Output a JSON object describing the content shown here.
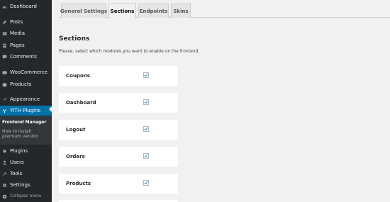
{
  "sidebar": {
    "items": [
      {
        "label": "Dashboard",
        "icon": "dashboard-icon"
      },
      {
        "label": "Posts",
        "icon": "pin-icon"
      },
      {
        "label": "Media",
        "icon": "media-icon"
      },
      {
        "label": "Pages",
        "icon": "page-icon"
      },
      {
        "label": "Comments",
        "icon": "comment-icon"
      },
      {
        "label": "WooCommerce",
        "icon": "woocommerce-icon"
      },
      {
        "label": "Products",
        "icon": "products-icon"
      },
      {
        "label": "Appearance",
        "icon": "brush-icon"
      },
      {
        "label": "YITH Plugins",
        "icon": "yith-icon"
      },
      {
        "label": "Plugins",
        "icon": "plug-icon"
      },
      {
        "label": "Users",
        "icon": "user-icon"
      },
      {
        "label": "Tools",
        "icon": "wrench-icon"
      },
      {
        "label": "Settings",
        "icon": "settings-icon"
      },
      {
        "label": "Collapse menu",
        "icon": "collapse-icon"
      }
    ],
    "submenu": {
      "title": "Frontend Manager",
      "link_line1": "How to install",
      "link_line2": "premium version"
    }
  },
  "tabs": [
    {
      "label": "General Settings",
      "active": false
    },
    {
      "label": "Sections",
      "active": true
    },
    {
      "label": "Endpoints",
      "active": false
    },
    {
      "label": "Skins",
      "active": false
    }
  ],
  "main": {
    "heading": "Sections",
    "description": "Please, select which modules you want to enable on the frontend."
  },
  "modules": [
    {
      "label": "Coupons",
      "checked": true
    },
    {
      "label": "Dashboard",
      "checked": true
    },
    {
      "label": "Logout",
      "checked": true
    },
    {
      "label": "Orders",
      "checked": true
    },
    {
      "label": "Products",
      "checked": true
    }
  ],
  "colors": {
    "sidebar_bg": "#23282d",
    "active_accent": "#0073aa",
    "check_color": "#1e8cbe",
    "page_bg": "#f1f1f1"
  }
}
